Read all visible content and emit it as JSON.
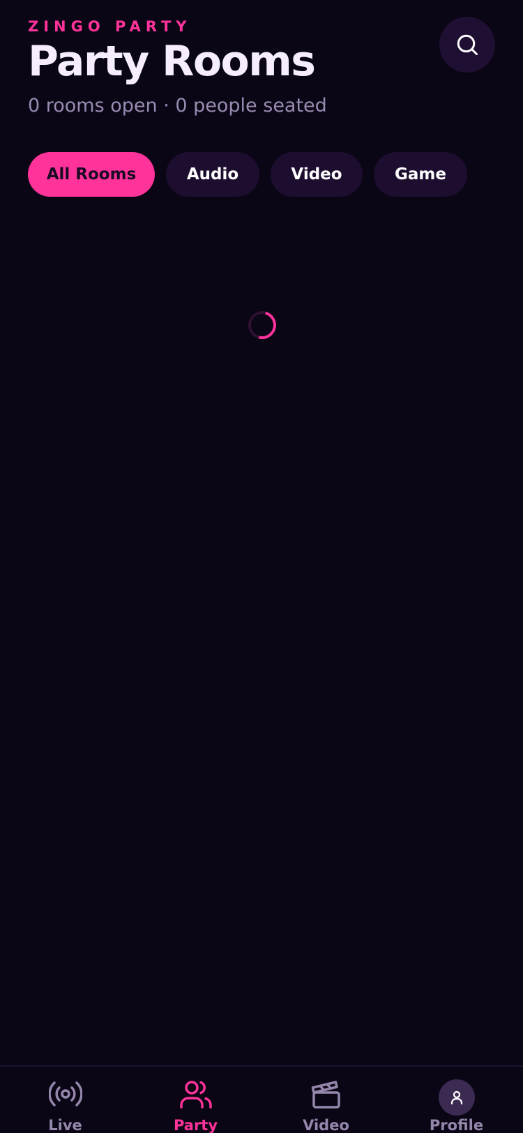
{
  "header": {
    "eyebrow": "ZINGO PARTY",
    "title": "Party Rooms",
    "subtitle": "0 rooms open · 0 people seated",
    "search_icon": "search-icon"
  },
  "filters": [
    {
      "label": "All Rooms",
      "active": true
    },
    {
      "label": "Audio",
      "active": false
    },
    {
      "label": "Video",
      "active": false
    },
    {
      "label": "Game",
      "active": false
    }
  ],
  "content": {
    "state": "loading"
  },
  "bottom_nav": [
    {
      "label": "Live",
      "icon": "broadcast-icon",
      "active": false
    },
    {
      "label": "Party",
      "icon": "users-icon",
      "active": true
    },
    {
      "label": "Video",
      "icon": "clapperboard-icon",
      "active": false
    },
    {
      "label": "Profile",
      "icon": "user-icon",
      "active": false
    }
  ],
  "colors": {
    "background": "#0a0616",
    "accent": "#ff3399",
    "chip_bg": "#1d0d2f",
    "text_primary": "#f6eefe",
    "text_muted": "#9a8bb2"
  }
}
